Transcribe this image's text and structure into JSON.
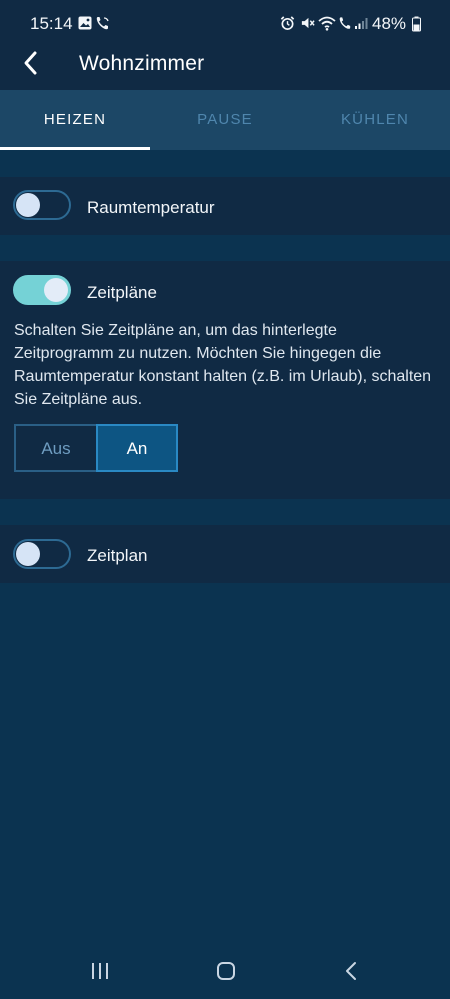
{
  "status_bar": {
    "time": "15:14",
    "battery": "48%"
  },
  "header": {
    "title": "Wohnzimmer"
  },
  "tabs": [
    {
      "label": "HEIZEN",
      "active": true
    },
    {
      "label": "PAUSE",
      "active": false
    },
    {
      "label": "KÜHLEN",
      "active": false
    }
  ],
  "cards": {
    "room_temp": {
      "label": "Raumtemperatur",
      "enabled": false
    },
    "schedules": {
      "label": "Zeitpläne",
      "enabled": true,
      "description": "Schalten Sie Zeitpläne an, um das hinterlegte Zeitprogramm zu nutzen. Möchten Sie hingegen die Raumtemperatur konstant halten (z.B. im Urlaub), schalten Sie Zeitpläne aus.",
      "segment_off": "Aus",
      "segment_on": "An",
      "selected": "An"
    },
    "schedule": {
      "label": "Zeitplan",
      "enabled": false
    }
  },
  "colors": {
    "background": "#0b3350",
    "card": "#102a44",
    "accent_toggle": "#75d2d6",
    "tab_inactive": "#4f86ad",
    "segment_selected": "#0d5583"
  },
  "icons": {
    "back": "arrow-left-icon",
    "nav_recent": "recent-apps-icon",
    "nav_home": "home-icon",
    "nav_back": "back-icon"
  }
}
